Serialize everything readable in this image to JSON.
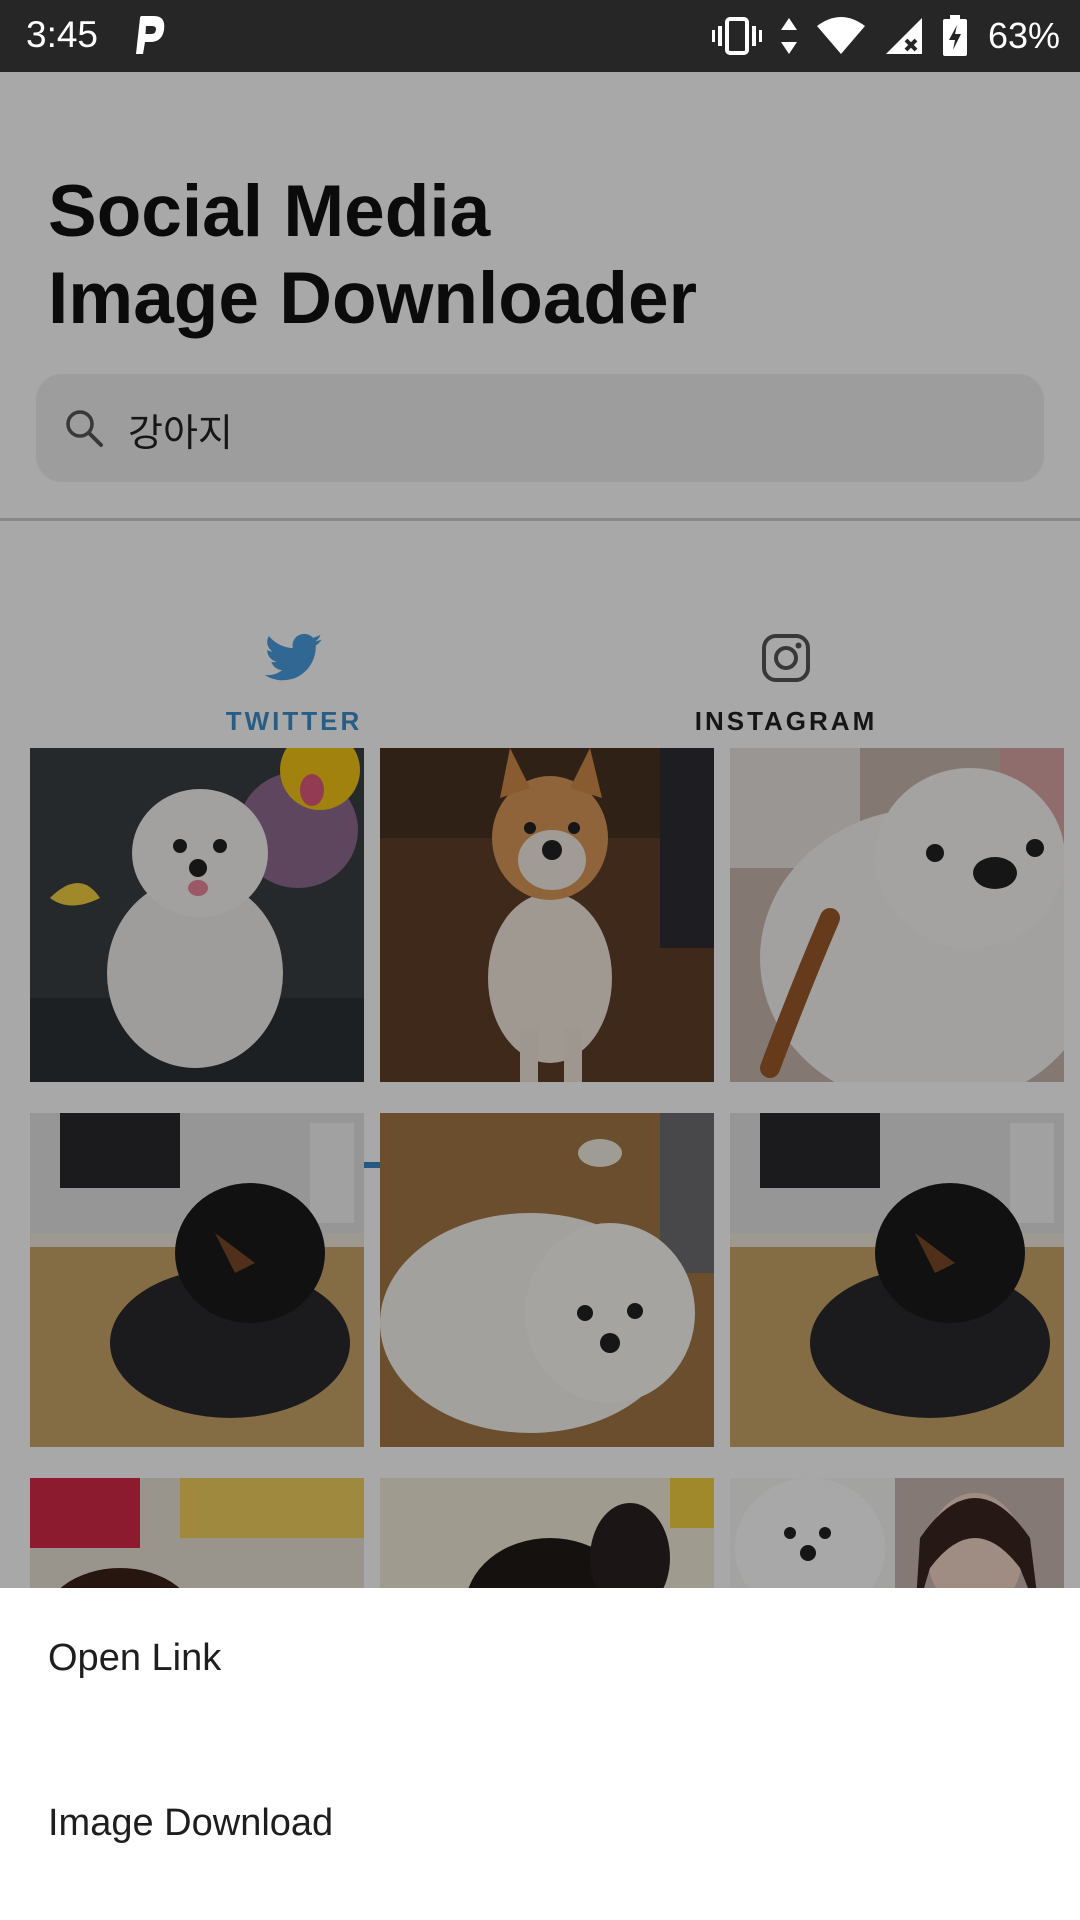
{
  "status_bar": {
    "time": "3:45",
    "battery_text": "63%",
    "icons": [
      "parking-p-icon",
      "vibrate-icon",
      "data-arrows-icon",
      "wifi-icon",
      "signal-icon",
      "battery-charging-icon"
    ]
  },
  "app": {
    "title_line1": "Social Media",
    "title_line2": "Image Downloader",
    "search": {
      "value": "강아지",
      "icon": "search-icon"
    }
  },
  "tabs": [
    {
      "label": "TWITTER",
      "icon": "twitter-bird-icon",
      "selected": true
    },
    {
      "label": "INSTAGRAM",
      "icon": "instagram-icon",
      "selected": false
    }
  ],
  "colors": {
    "accent": "#3a86c4",
    "status_bar": "#262626",
    "search_bg": "#eeeeee",
    "scrim": "rgba(0,0,0,0.34)"
  },
  "grid_images": [
    {
      "alt": "white pomeranian on dark rug"
    },
    {
      "alt": "shiba inu on wooden floor"
    },
    {
      "alt": "white fluffy dog close-up"
    },
    {
      "alt": "black dog on wooden floor"
    },
    {
      "alt": "white pomeranian on wooden floor"
    },
    {
      "alt": "black dog on wooden floor"
    },
    {
      "alt": "dog on blanket"
    },
    {
      "alt": "black dog on floral blanket"
    },
    {
      "alt": "white pomeranian and person"
    }
  ],
  "bottom_sheet": {
    "items": [
      {
        "label": "Open Link"
      },
      {
        "label": "Image Download"
      }
    ]
  }
}
